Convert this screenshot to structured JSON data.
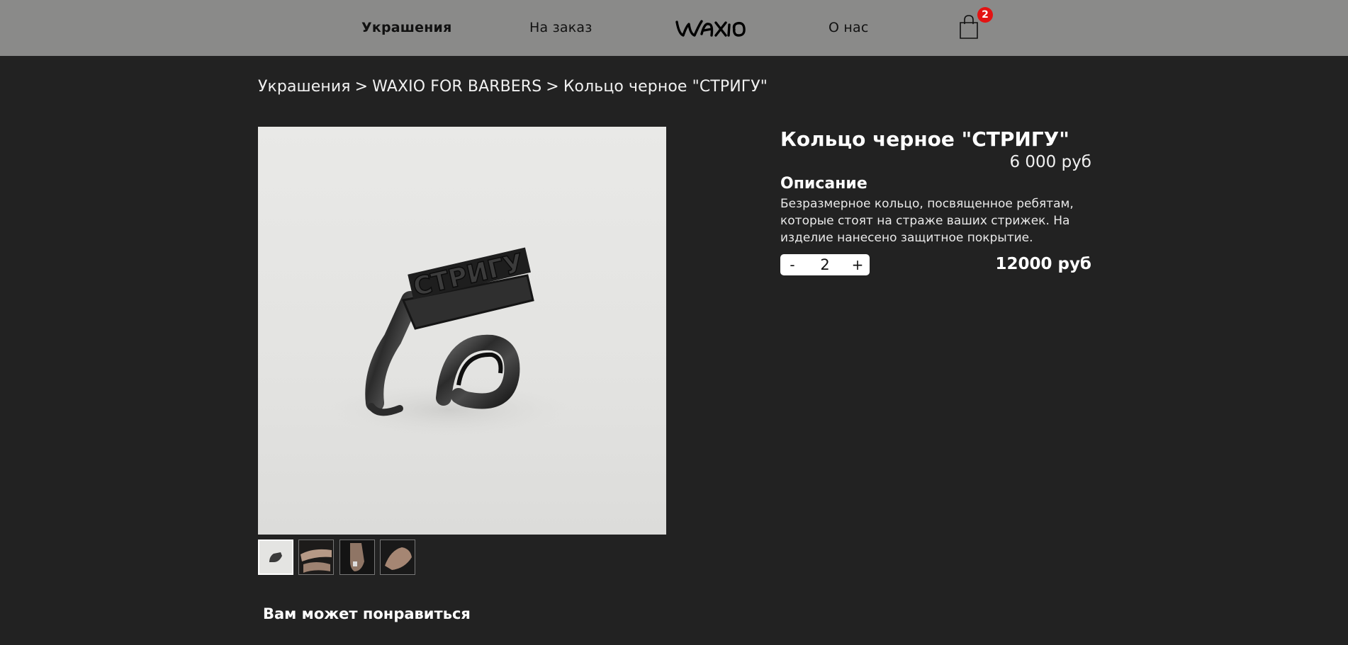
{
  "header": {
    "nav": {
      "jewelry": "Украшения",
      "custom": "На заказ",
      "about": "О нас"
    },
    "logo_text": "WAXIO",
    "cart_count": "2"
  },
  "breadcrumb": {
    "items": [
      "Украшения",
      "WAXIO FOR BARBERS",
      "Кольцо черное \"СТРИГУ\""
    ],
    "separator": ">"
  },
  "product": {
    "title": "Кольцо черное \"СТРИГУ\"",
    "unit_price": "6 000 руб",
    "description_heading": "Описание",
    "description": "Безразмерное кольцо, посвященное ребятам, которые стоят на страже ваших стрижек. На изделие нанесено защитное покрытие.",
    "quantity": "2",
    "minus_label": "-",
    "plus_label": "+",
    "total_price": "12000 руб",
    "image_lettering": "СТРИГУ",
    "thumbnail_count": 4,
    "selected_thumbnail": 1
  },
  "recommend": {
    "heading": "Вам может понравиться"
  },
  "colors": {
    "background": "#222222",
    "header": "#8a8a89",
    "badge": "#e31313"
  }
}
